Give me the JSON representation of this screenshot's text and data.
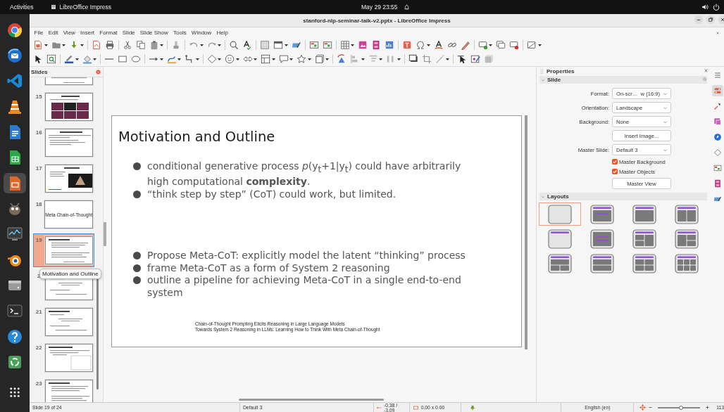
{
  "top_bar": {
    "activities": "Activities",
    "app_name": "LibreOffice Impress",
    "clock": "May 29  23:55"
  },
  "dock": [
    {
      "kind": "browser",
      "selected": false
    },
    {
      "kind": "mail",
      "selected": false
    },
    {
      "kind": "code",
      "selected": false
    },
    {
      "kind": "media",
      "selected": false
    },
    {
      "kind": "writer",
      "selected": false
    },
    {
      "kind": "calc",
      "selected": false
    },
    {
      "kind": "impress",
      "selected": true
    },
    {
      "kind": "paint",
      "selected": false
    },
    {
      "kind": "monitor",
      "selected": false
    },
    {
      "kind": "blender",
      "selected": false
    },
    {
      "kind": "drive",
      "selected": false
    },
    {
      "kind": "terminal",
      "selected": false
    },
    {
      "kind": "help",
      "selected": false
    },
    {
      "kind": "trash",
      "selected": false
    },
    {
      "kind": "apps",
      "selected": false
    }
  ],
  "window": {
    "title": "stanford-nlp-seminar-talk-v2.pptx - LibreOffice Impress"
  },
  "menu": [
    "File",
    "Edit",
    "View",
    "Insert",
    "Format",
    "Slide",
    "Slide Show",
    "Tools",
    "Window",
    "Help"
  ],
  "slides_panel": {
    "title": "Slides",
    "tooltip": "Motivation and Outline",
    "slides": [
      {
        "kind": "text",
        "selected": false
      },
      {
        "number": "15",
        "kind": "image-grid",
        "selected": false
      },
      {
        "number": "16",
        "kind": "checklist",
        "selected": false
      },
      {
        "number": "17",
        "kind": "image-right",
        "selected": false
      },
      {
        "number": "18",
        "kind": "title",
        "title": "Meta Chain-of-Thought",
        "selected": false
      },
      {
        "number": "19",
        "kind": "text",
        "selected": true
      },
      {
        "number": "2",
        "kind": "equation",
        "selected": false
      },
      {
        "number": "21",
        "kind": "equation",
        "selected": false
      },
      {
        "number": "22",
        "kind": "figure",
        "selected": false
      },
      {
        "number": "23",
        "kind": "text",
        "selected": false
      }
    ]
  },
  "slide": {
    "title": "Motivation and Outline",
    "groups": [
      [
        "conditional generative process *p*(y$_{t}$+1|y$_{t}$) could have arbitrarily high computational **complexity**.",
        "“think step by step” (CoT) could work, but limited."
      ],
      [
        "Propose Meta-CoT: explicitly model the latent “thinking” process",
        "frame Meta-CoT as a form of System 2 reasoning",
        "outline a pipeline for achieving Meta-CoT in a single end-to-end system"
      ]
    ],
    "references": [
      "Chain-of-Thought Prompting Elicits Reasoning in Large Language Models",
      "Towards System 2 Reasoning in LLMs: Learning How to Think With Meta Chain-of-Thought"
    ]
  },
  "properties": {
    "title": "Properties",
    "section": "Slide",
    "fields": [
      {
        "kind": "select",
        "label": "Format:",
        "value": "On-scr…  w (16:9)"
      },
      {
        "kind": "select",
        "label": "Orientation:",
        "value": "Landscape"
      },
      {
        "kind": "select",
        "label": "Background:",
        "value": "None"
      },
      {
        "kind": "button",
        "label": "Insert Image..."
      },
      {
        "kind": "select",
        "label": "Master Slide:",
        "value": "Default 3"
      }
    ],
    "checkboxes": [
      {
        "label": "Master Background",
        "checked": true
      },
      {
        "label": "Master Objects",
        "checked": true
      }
    ],
    "master_view": "Master View",
    "layouts_title": "Layouts",
    "layouts": [
      {
        "kind": "blank",
        "selected": true
      },
      {
        "kind": "title-slide",
        "selected": false
      },
      {
        "kind": "title-content",
        "selected": false
      },
      {
        "kind": "title-2content",
        "selected": false
      },
      {
        "kind": "title-only",
        "selected": false
      },
      {
        "kind": "centered-text",
        "selected": false
      },
      {
        "kind": "title-2content-content",
        "selected": false
      },
      {
        "kind": "title-content-2content",
        "selected": false
      },
      {
        "kind": "title-2content-over-content",
        "selected": false
      },
      {
        "kind": "title-content-over-content",
        "selected": false
      },
      {
        "kind": "title-4content",
        "selected": false
      },
      {
        "kind": "title-6content",
        "selected": false
      }
    ]
  },
  "sidebar_tabs": [
    {
      "kind": "menu",
      "selected": false
    },
    {
      "kind": "properties",
      "selected": true
    },
    {
      "kind": "styles",
      "selected": false
    },
    {
      "kind": "gallery",
      "selected": false
    },
    {
      "kind": "navigator",
      "selected": false
    },
    {
      "kind": "shapes",
      "selected": false
    },
    {
      "kind": "transition",
      "selected": false
    },
    {
      "kind": "animation",
      "selected": false
    },
    {
      "kind": "master",
      "selected": false
    }
  ],
  "status_bar": {
    "slide": "Slide 19 of 24",
    "master": "Default 3",
    "position": "-0.38 / -3.09",
    "size": "0.00 x 0.00",
    "language": "English (en)",
    "zoom": {
      "level": 0.55,
      "reading": "113"
    }
  }
}
